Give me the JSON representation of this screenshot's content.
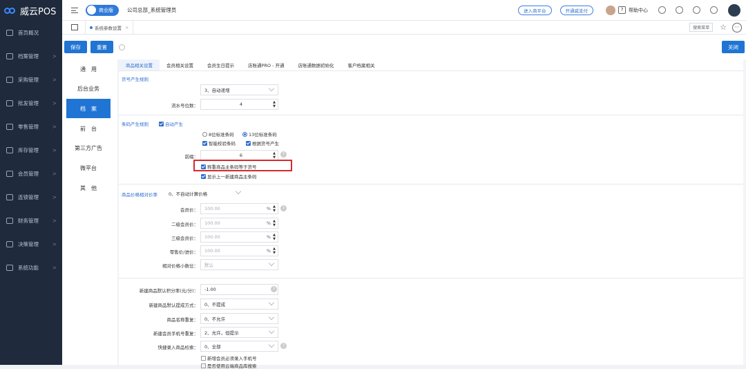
{
  "app": {
    "logo": "威云POS"
  },
  "sidebar": {
    "items": [
      {
        "label": "首页概况",
        "icon": "home-icon",
        "chev": ""
      },
      {
        "label": "档案管理",
        "icon": "archive-icon",
        "chev": ">"
      },
      {
        "label": "采购管理",
        "icon": "cart-icon",
        "chev": ">"
      },
      {
        "label": "批发管理",
        "icon": "wholesale-icon",
        "chev": ">"
      },
      {
        "label": "零售管理",
        "icon": "retail-icon",
        "chev": ">"
      },
      {
        "label": "库存管理",
        "icon": "inventory-icon",
        "chev": ">"
      },
      {
        "label": "会员管理",
        "icon": "member-icon",
        "chev": ">"
      },
      {
        "label": "连锁管理",
        "icon": "chain-icon",
        "chev": ">"
      },
      {
        "label": "财务管理",
        "icon": "finance-icon",
        "chev": ">"
      },
      {
        "label": "决策管理",
        "icon": "decision-icon",
        "chev": ">"
      },
      {
        "label": "系统功能",
        "icon": "settings-icon",
        "chev": ">"
      }
    ]
  },
  "topbar": {
    "edition": "商业版",
    "company": "公司总部_系统管理员",
    "enter_platform": "进入商平台",
    "open_pay": "开通威支付",
    "help_q": "?",
    "help": "帮助中心"
  },
  "tabbar": {
    "page_tab": "系统参数设置",
    "close": "×",
    "menu_search": "搜索菜单",
    "more": "⋯"
  },
  "toolbar": {
    "save": "保存",
    "reset": "重置",
    "close": "关闭"
  },
  "left_menu": [
    "通　用",
    "后台业务",
    "档　案",
    "前　台",
    "第三方广告",
    "微平台",
    "其　他"
  ],
  "content_tabs": [
    "商品相关设置",
    "会员相关设置",
    "会员生日提示",
    "店账通PRO - 开通",
    "店账通数据初始化",
    "客户档案相关"
  ],
  "goods_code": {
    "section": "货号产生规则",
    "rule_value": "3、自动递增",
    "serial_label": "流水号位数：",
    "serial_value": "4"
  },
  "barcode": {
    "section": "条码产生规则",
    "auto_label": "自动产生",
    "opt_8": "8位标准条码",
    "opt_13": "13位标准条码",
    "smart_check": "智能校验条码",
    "by_goods_code": "根据货号产生",
    "prefix_label": "前缀：",
    "prefix_value": "6",
    "weighing": "称重商品主条码等于货号",
    "show_last": "显示上一新建商品主条码"
  },
  "price_ratio": {
    "section": "商品价格相对价率",
    "mode": "0、不自动计算价格",
    "rows": [
      {
        "label": "会员价：",
        "value": "100.00"
      },
      {
        "label": "二级会员价：",
        "value": "100.00"
      },
      {
        "label": "三级会员价：",
        "value": "100.00"
      },
      {
        "label": "零售价/进价：",
        "value": "100.00"
      }
    ],
    "pct": "%",
    "decimal_label": "相对价格小数位：",
    "decimal_value": "默认"
  },
  "new_goods": {
    "rows": [
      {
        "label": "新建商品默认积分率(元/分)：",
        "value": "-1.00"
      },
      {
        "label": "新建商品默认提成方式：",
        "value": "0、不提成"
      },
      {
        "label": "商品名称重复：",
        "value": "0、不允许"
      },
      {
        "label": "新建会员手机号重复：",
        "value": "2、允许，但提示"
      },
      {
        "label": "快捷录入商品检索：",
        "value": "0、全部"
      }
    ],
    "must_phone": "新增会员必须录入手机号",
    "cloud_db": "是否使用云端商品库搜索"
  }
}
